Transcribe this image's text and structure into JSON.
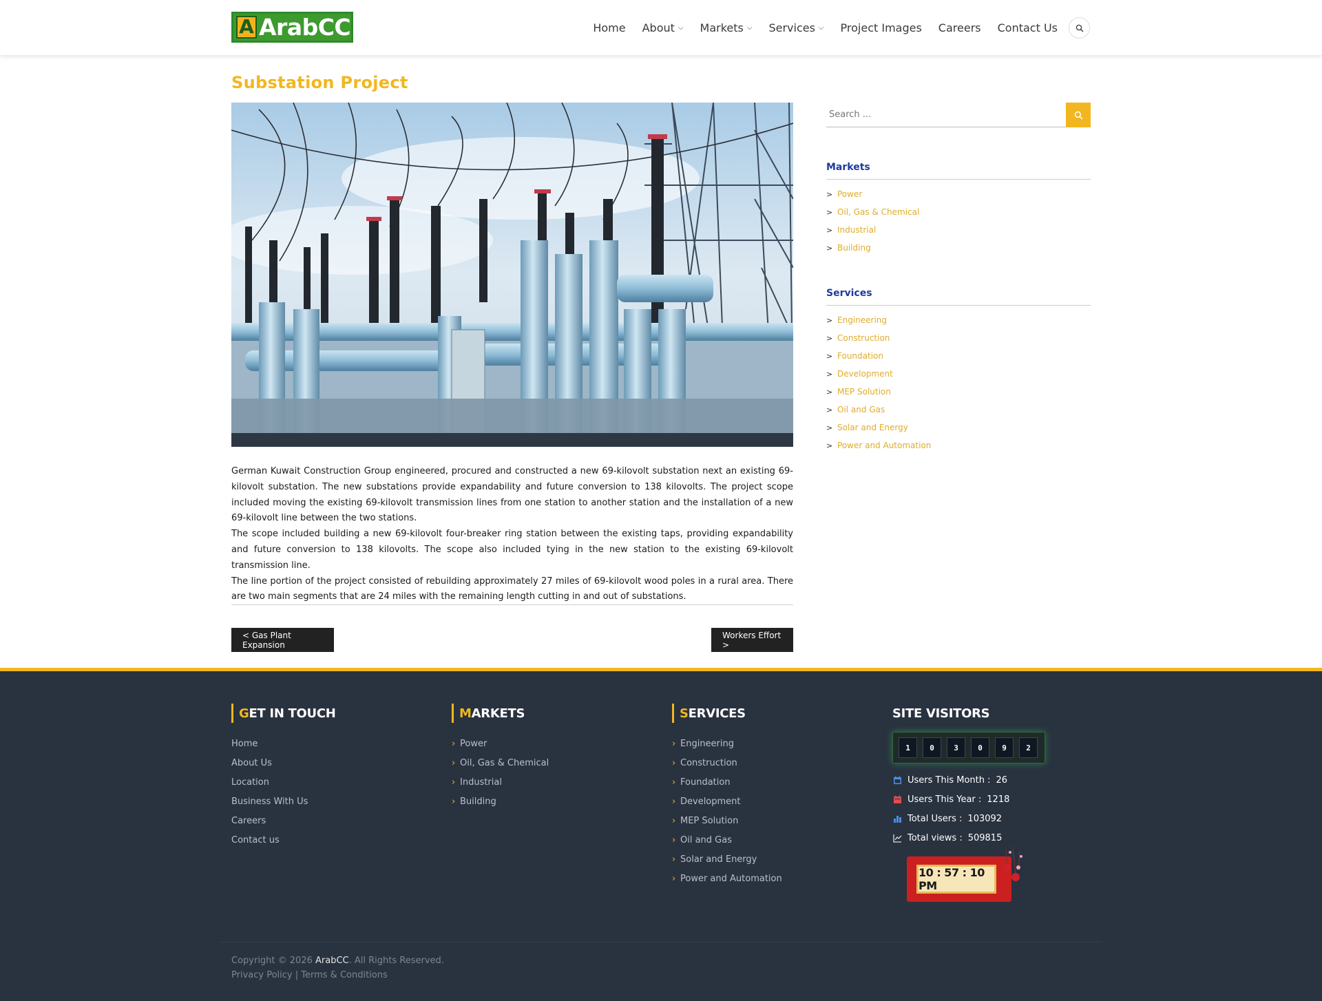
{
  "header": {
    "logo_text": "ArabCC",
    "logo_mark": "A",
    "nav": [
      {
        "label": "Home",
        "dropdown": false
      },
      {
        "label": "About",
        "dropdown": true
      },
      {
        "label": "Markets",
        "dropdown": true
      },
      {
        "label": "Services",
        "dropdown": true
      },
      {
        "label": "Project Images",
        "dropdown": false
      },
      {
        "label": "Careers",
        "dropdown": false
      },
      {
        "label": "Contact Us",
        "dropdown": false
      }
    ],
    "search_icon": "search-icon"
  },
  "main": {
    "title": "Substation Project",
    "hero_icon": "substation-photo",
    "paragraphs": [
      "German Kuwait Construction Group engineered, procured and constructed a new 69-kilovolt substation next an existing 69-kilovolt substation. The new substations provide expandability and future conversion to 138 kilovolts. The project scope included moving the existing 69-kilovolt transmission lines from one station to another station and the installation of a new 69-kilovolt line between the two stations.",
      "The scope included building a new 69-kilovolt four-breaker ring station between the existing taps, providing expandability and future conversion to 138 kilovolts. The scope also included tying in the new station to the existing 69-kilovolt transmission line.",
      "The line portion of the project consisted of rebuilding approximately 27 miles of 69-kilovolt wood poles in a rural area. There are two main segments that are 24 miles with the remaining length cutting in and out of substations."
    ],
    "prev_post": "< Gas Plant Expansion",
    "next_post": "Workers Effort >"
  },
  "sidebar": {
    "search_placeholder": "Search ...",
    "markets_title": "Markets",
    "markets": [
      "Power",
      "Oil, Gas & Chemical",
      "Industrial",
      "Building"
    ],
    "services_title": "Services",
    "services": [
      "Engineering",
      "Construction",
      "Foundation",
      "Development",
      "MEP Solution",
      "Oil and Gas",
      "Solar and Energy",
      "Power and Automation"
    ],
    "bullet": ">"
  },
  "footer": {
    "contact_title_first": "G",
    "contact_title_rest": "ET IN TOUCH",
    "contact_links": [
      "Home",
      "About Us",
      "Location",
      "Business With Us",
      "Careers",
      "Contact us"
    ],
    "markets_title_first": "M",
    "markets_title_rest": "ARKETS",
    "markets_links": [
      "Power",
      "Oil, Gas & Chemical",
      "Industrial",
      "Building"
    ],
    "services_title_first": "S",
    "services_title_rest": "ERVICES",
    "services_links": [
      "Engineering",
      "Construction",
      "Foundation",
      "Development",
      "MEP Solution",
      "Oil and Gas",
      "Solar and Energy",
      "Power and Automation"
    ],
    "visitors_title": "SITE VISITORS",
    "counter_digits": [
      "1",
      "0",
      "3",
      "0",
      "9",
      "2"
    ],
    "stats": [
      {
        "label": "Users This Month :",
        "value": "26",
        "icon": "calendar-icon",
        "color": "#4a8fe7"
      },
      {
        "label": "Users This Year :",
        "value": "1218",
        "icon": "calendar-year-icon",
        "color": "#e34b4b"
      },
      {
        "label": "Total Users :",
        "value": "103092",
        "icon": "bar-chart-icon",
        "color": "#4a8fe7"
      },
      {
        "label": "Total views :",
        "value": "509815",
        "icon": "line-chart-icon",
        "color": "#d9dde3"
      }
    ],
    "clock_time": "10 : 57 : 10 PM",
    "copyright_prefix": "Copyright © 2026 ",
    "copyright_brand": "ArabCC",
    "copyright_suffix": ". All Rights Reserved.",
    "privacy": "Privacy Policy",
    "legal_sep": " | ",
    "terms": "Terms & Conditions",
    "list_bullet": "›"
  },
  "colors": {
    "accent": "#f2b720",
    "footer_bg": "#29323f",
    "sidebar_heading": "#1e3a9e",
    "sidebar_link": "#e0ac2b"
  }
}
